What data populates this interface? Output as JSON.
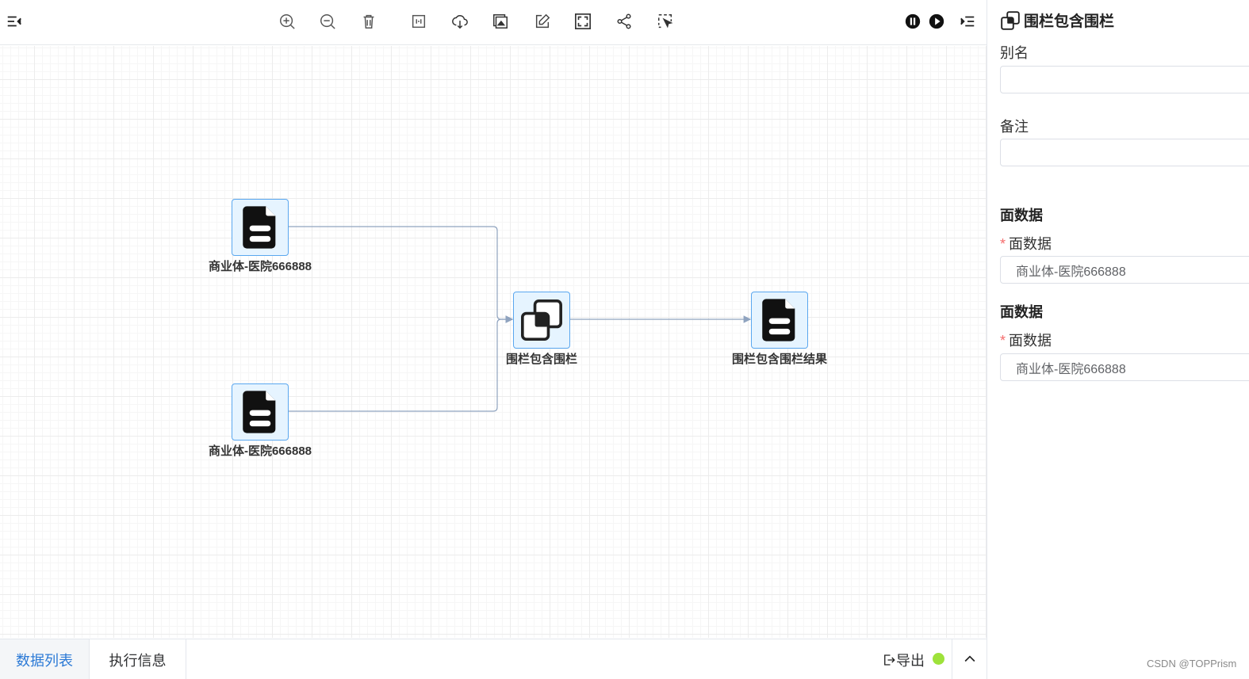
{
  "toolbar": {
    "left_icon": "menu-fold-icon",
    "tools": [
      {
        "name": "zoom-in-icon"
      },
      {
        "name": "zoom-out-icon"
      },
      {
        "name": "delete-icon"
      },
      {
        "name": "fit-icon"
      },
      {
        "name": "cloud-download-icon"
      },
      {
        "name": "export-image-icon"
      },
      {
        "name": "edit-icon"
      },
      {
        "name": "fullscreen-icon"
      },
      {
        "name": "share-icon"
      },
      {
        "name": "select-icon"
      }
    ],
    "right_icons": [
      "pause-icon",
      "play-icon",
      "indent-icon"
    ]
  },
  "nodes": [
    {
      "id": "source-1",
      "label": "商业体-医院666888",
      "icon": "file-icon"
    },
    {
      "id": "source-2",
      "label": "商业体-医院666888",
      "icon": "file-icon"
    },
    {
      "id": "operator",
      "label": "围栏包含围栏",
      "icon": "overlap-squares-icon"
    },
    {
      "id": "result",
      "label": "围栏包含围栏结果",
      "icon": "file-icon"
    }
  ],
  "bottom": {
    "tabs": [
      {
        "label": "数据列表",
        "active": true
      },
      {
        "label": "执行信息",
        "active": false
      }
    ],
    "export_label": "导出",
    "status_color": "#9ee23a"
  },
  "panel": {
    "title": "围栏包含围栏",
    "alias_label": "别名",
    "alias_value": "",
    "remark_label": "备注",
    "remark_value": "",
    "groups": [
      {
        "section": "面数据",
        "required_mark": "*",
        "label": "面数据",
        "value": "商业体-医院666888"
      },
      {
        "section": "面数据",
        "required_mark": "*",
        "label": "面数据",
        "value": "商业体-医院666888"
      }
    ]
  },
  "colors": {
    "accent": "#2c7ad6",
    "node_border": "#5aa7ef",
    "node_bg": "#e6f4ff",
    "edge": "#8fa3bf",
    "required": "#f56c6c"
  },
  "watermark": "CSDN @TOPPrism"
}
